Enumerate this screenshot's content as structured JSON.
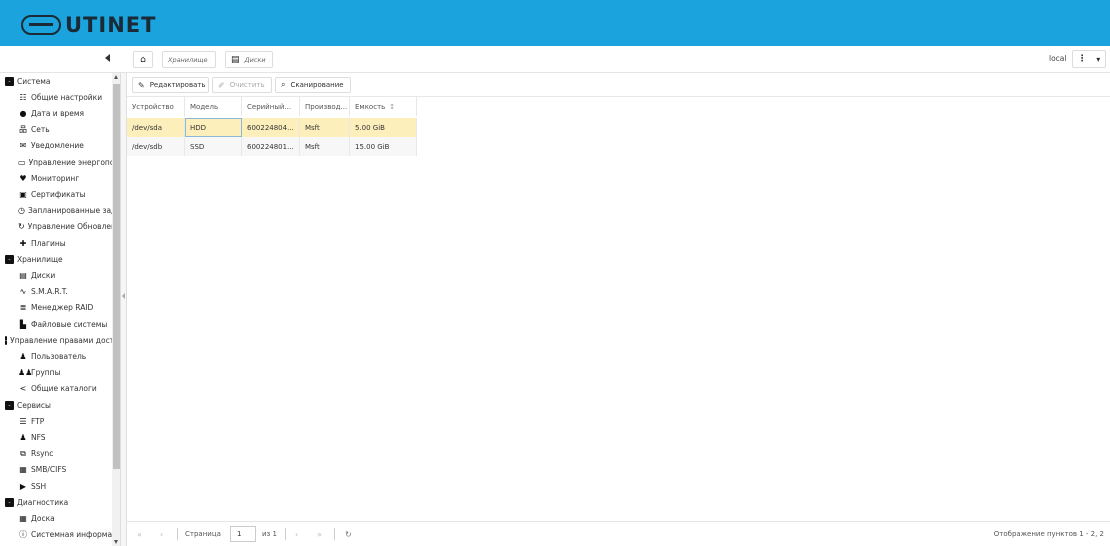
{
  "header": {
    "logo_text": "UTINET",
    "bar_color": "#1aa3dc"
  },
  "breadcrumb": {
    "storage": "Хранилище",
    "disks": "Диски"
  },
  "top_right": {
    "host": "local",
    "menu_icon": "⋮",
    "dropdown_icon": "▾"
  },
  "sidebar": {
    "items": [
      {
        "label": "Система",
        "icon": "-",
        "kind": "group"
      },
      {
        "label": "Общие настройки",
        "icon": "☷",
        "kind": "child"
      },
      {
        "label": "Дата и время",
        "icon": "●",
        "kind": "child"
      },
      {
        "label": "Сеть",
        "icon": "品",
        "kind": "child"
      },
      {
        "label": "Уведомление",
        "icon": "✉",
        "kind": "child"
      },
      {
        "label": "Управление энергопотреблением",
        "icon": "▭",
        "kind": "child"
      },
      {
        "label": "Мониторинг",
        "icon": "♥",
        "kind": "child"
      },
      {
        "label": "Сертификаты",
        "icon": "▣",
        "kind": "child"
      },
      {
        "label": "Запланированные задачи",
        "icon": "◷",
        "kind": "child"
      },
      {
        "label": "Управление Обновлениями",
        "icon": "↻",
        "kind": "child"
      },
      {
        "label": "Плагины",
        "icon": "✚",
        "kind": "child"
      },
      {
        "label": "Хранилище",
        "icon": "-",
        "kind": "group"
      },
      {
        "label": "Диски",
        "icon": "▤",
        "kind": "child"
      },
      {
        "label": "S.M.A.R.T.",
        "icon": "∿",
        "kind": "child"
      },
      {
        "label": "Менеджер RAID",
        "icon": "≣",
        "kind": "child"
      },
      {
        "label": "Файловые системы",
        "icon": "▙",
        "kind": "child"
      },
      {
        "label": "Управление правами доступа",
        "icon": "-",
        "kind": "group"
      },
      {
        "label": "Пользователь",
        "icon": "♟",
        "kind": "child"
      },
      {
        "label": "Группы",
        "icon": "♟♟",
        "kind": "child"
      },
      {
        "label": "Общие каталоги",
        "icon": "<",
        "kind": "child"
      },
      {
        "label": "Сервисы",
        "icon": "-",
        "kind": "group"
      },
      {
        "label": "FTP",
        "icon": "☰",
        "kind": "child"
      },
      {
        "label": "NFS",
        "icon": "♟",
        "kind": "child"
      },
      {
        "label": "Rsync",
        "icon": "⧉",
        "kind": "child"
      },
      {
        "label": "SMB/CIFS",
        "icon": "▦",
        "kind": "child"
      },
      {
        "label": "SSH",
        "icon": "▶",
        "kind": "child"
      },
      {
        "label": "Диагностика",
        "icon": "-",
        "kind": "group"
      },
      {
        "label": "Доска",
        "icon": "▦",
        "kind": "child"
      },
      {
        "label": "Системная информация",
        "icon": "ⓘ",
        "kind": "child"
      }
    ]
  },
  "actions": {
    "edit": "Редактировать",
    "clear": "Очистить",
    "scan": "Сканирование"
  },
  "table": {
    "columns": [
      "Устройство",
      "Модель",
      "Серийный...",
      "Производ...",
      "Емкость"
    ],
    "rows": [
      [
        "/dev/sda",
        "HDD",
        "600224804...",
        "Msft",
        "5.00 GiB"
      ],
      [
        "/dev/sdb",
        "SSD",
        "600224801...",
        "Msft",
        "15.00 GiB"
      ]
    ]
  },
  "pager": {
    "page_label": "Страница",
    "page_value": "1",
    "of_label": "из 1",
    "display_info": "Отображение пунктов 1 - 2, 2"
  }
}
